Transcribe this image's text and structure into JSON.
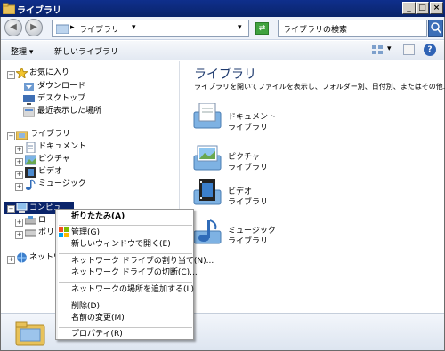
{
  "window": {
    "title": "ライブラリ",
    "minimize": "_",
    "maximize": "□",
    "close": "×"
  },
  "address": {
    "breadcrumb": "ライブラリ",
    "sep": "▸",
    "search_placeholder": "ライブラリの検索"
  },
  "toolbar": {
    "organize": "整理",
    "new_library": "新しいライブラリ"
  },
  "nav": {
    "favorites": "お気に入り",
    "favorites_items": [
      "ダウンロード",
      "デスクトップ",
      "最近表示した場所"
    ],
    "libraries": "ライブラリ",
    "libraries_items": [
      "ドキュメント",
      "ピクチャ",
      "ビデオ",
      "ミュージック"
    ],
    "computer": "コンピュ",
    "computer_items": [
      "ローカ",
      "ボリュ"
    ],
    "network": "ネットワー"
  },
  "content": {
    "title": "ライブラリ",
    "subtitle": "ライブラリを開いてファイルを表示し、フォルダー別、日付別、またはその他...",
    "libraries": [
      {
        "name": "ドキュメント",
        "type": "ライブラリ"
      },
      {
        "name": "ピクチャ",
        "type": "ライブラリ"
      },
      {
        "name": "ビデオ",
        "type": "ライブラリ"
      },
      {
        "name": "ミュージック",
        "type": "ライブラリ"
      }
    ]
  },
  "context_menu": {
    "collapse": "折りたたみ(A)",
    "manage": "管理(G)",
    "open_new_window": "新しいウィンドウで開く(E)",
    "map_drive": "ネットワーク ドライブの割り当て(N)...",
    "disconnect_drive": "ネットワーク ドライブの切断(C)...",
    "add_network_location": "ネットワークの場所を追加する(L)",
    "delete": "削除(D)",
    "rename": "名前の変更(M)",
    "properties": "プロパティ(R)"
  },
  "colors": {
    "titlebar": "#0a246a",
    "selection": "#0a246a",
    "link_blue": "#1e3a6e"
  }
}
